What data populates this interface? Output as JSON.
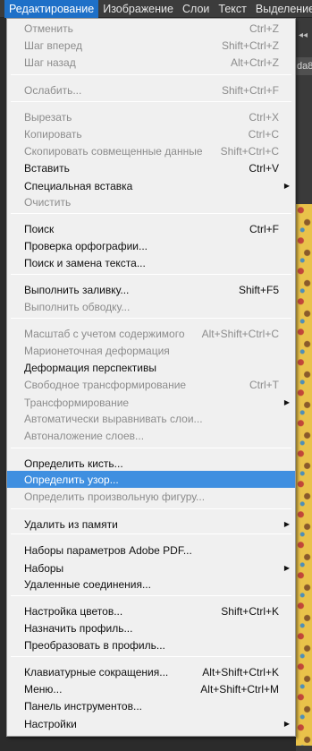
{
  "menubar": {
    "items": [
      "Редактирование",
      "Изображение",
      "Слои",
      "Текст",
      "Выделение"
    ]
  },
  "background": {
    "tab_text": "da8"
  },
  "menu": {
    "items": [
      {
        "label": "Отменить",
        "shortcut": "Ctrl+Z",
        "disabled": true
      },
      {
        "label": "Шаг вперед",
        "shortcut": "Shift+Ctrl+Z",
        "disabled": true
      },
      {
        "label": "Шаг назад",
        "shortcut": "Alt+Ctrl+Z",
        "disabled": true
      },
      {
        "label": "Ослабить...",
        "shortcut": "Shift+Ctrl+F",
        "disabled": true
      },
      {
        "label": "Вырезать",
        "shortcut": "Ctrl+X",
        "disabled": true
      },
      {
        "label": "Копировать",
        "shortcut": "Ctrl+C",
        "disabled": true
      },
      {
        "label": "Скопировать совмещенные данные",
        "shortcut": "Shift+Ctrl+C",
        "disabled": true
      },
      {
        "label": "Вставить",
        "shortcut": "Ctrl+V",
        "disabled": false
      },
      {
        "label": "Специальная вставка",
        "shortcut": "",
        "disabled": false,
        "submenu": true
      },
      {
        "label": "Очистить",
        "shortcut": "",
        "disabled": true
      },
      {
        "label": "Поиск",
        "shortcut": "Ctrl+F",
        "disabled": false
      },
      {
        "label": "Проверка орфографии...",
        "shortcut": "",
        "disabled": false
      },
      {
        "label": "Поиск и замена текста...",
        "shortcut": "",
        "disabled": false
      },
      {
        "label": "Выполнить заливку...",
        "shortcut": "Shift+F5",
        "disabled": false
      },
      {
        "label": "Выполнить обводку...",
        "shortcut": "",
        "disabled": true
      },
      {
        "label": "Масштаб с учетом содержимого",
        "shortcut": "Alt+Shift+Ctrl+C",
        "disabled": true
      },
      {
        "label": "Марионеточная деформация",
        "shortcut": "",
        "disabled": true
      },
      {
        "label": "Деформация перспективы",
        "shortcut": "",
        "disabled": false
      },
      {
        "label": "Свободное трансформирование",
        "shortcut": "Ctrl+T",
        "disabled": true
      },
      {
        "label": "Трансформирование",
        "shortcut": "",
        "disabled": true,
        "submenu": true
      },
      {
        "label": "Автоматически выравнивать слои...",
        "shortcut": "",
        "disabled": true
      },
      {
        "label": "Автоналожение слоев...",
        "shortcut": "",
        "disabled": true
      },
      {
        "label": "Определить кисть...",
        "shortcut": "",
        "disabled": false
      },
      {
        "label": "Определить узор...",
        "shortcut": "",
        "disabled": false,
        "highlighted": true
      },
      {
        "label": "Определить произвольную фигуру...",
        "shortcut": "",
        "disabled": true
      },
      {
        "label": "Удалить из памяти",
        "shortcut": "",
        "disabled": false,
        "submenu": true
      },
      {
        "label": "Наборы параметров Adobe PDF...",
        "shortcut": "",
        "disabled": false
      },
      {
        "label": "Наборы",
        "shortcut": "",
        "disabled": false,
        "submenu": true
      },
      {
        "label": "Удаленные соединения...",
        "shortcut": "",
        "disabled": false
      },
      {
        "label": "Настройка цветов...",
        "shortcut": "Shift+Ctrl+K",
        "disabled": false
      },
      {
        "label": "Назначить профиль...",
        "shortcut": "",
        "disabled": false
      },
      {
        "label": "Преобразовать в профиль...",
        "shortcut": "",
        "disabled": false
      },
      {
        "label": "Клавиатурные сокращения...",
        "shortcut": "Alt+Shift+Ctrl+K",
        "disabled": false
      },
      {
        "label": "Меню...",
        "shortcut": "Alt+Shift+Ctrl+M",
        "disabled": false
      },
      {
        "label": "Панель инструментов...",
        "shortcut": "",
        "disabled": false
      },
      {
        "label": "Настройки",
        "shortcut": "",
        "disabled": false,
        "submenu": true
      }
    ],
    "submenu_icon": "chevron-right-icon",
    "colors": {
      "menu_bg": "#f0f0f0",
      "highlight": "#3f8fe0",
      "menubar_active": "#1e70c8"
    }
  }
}
